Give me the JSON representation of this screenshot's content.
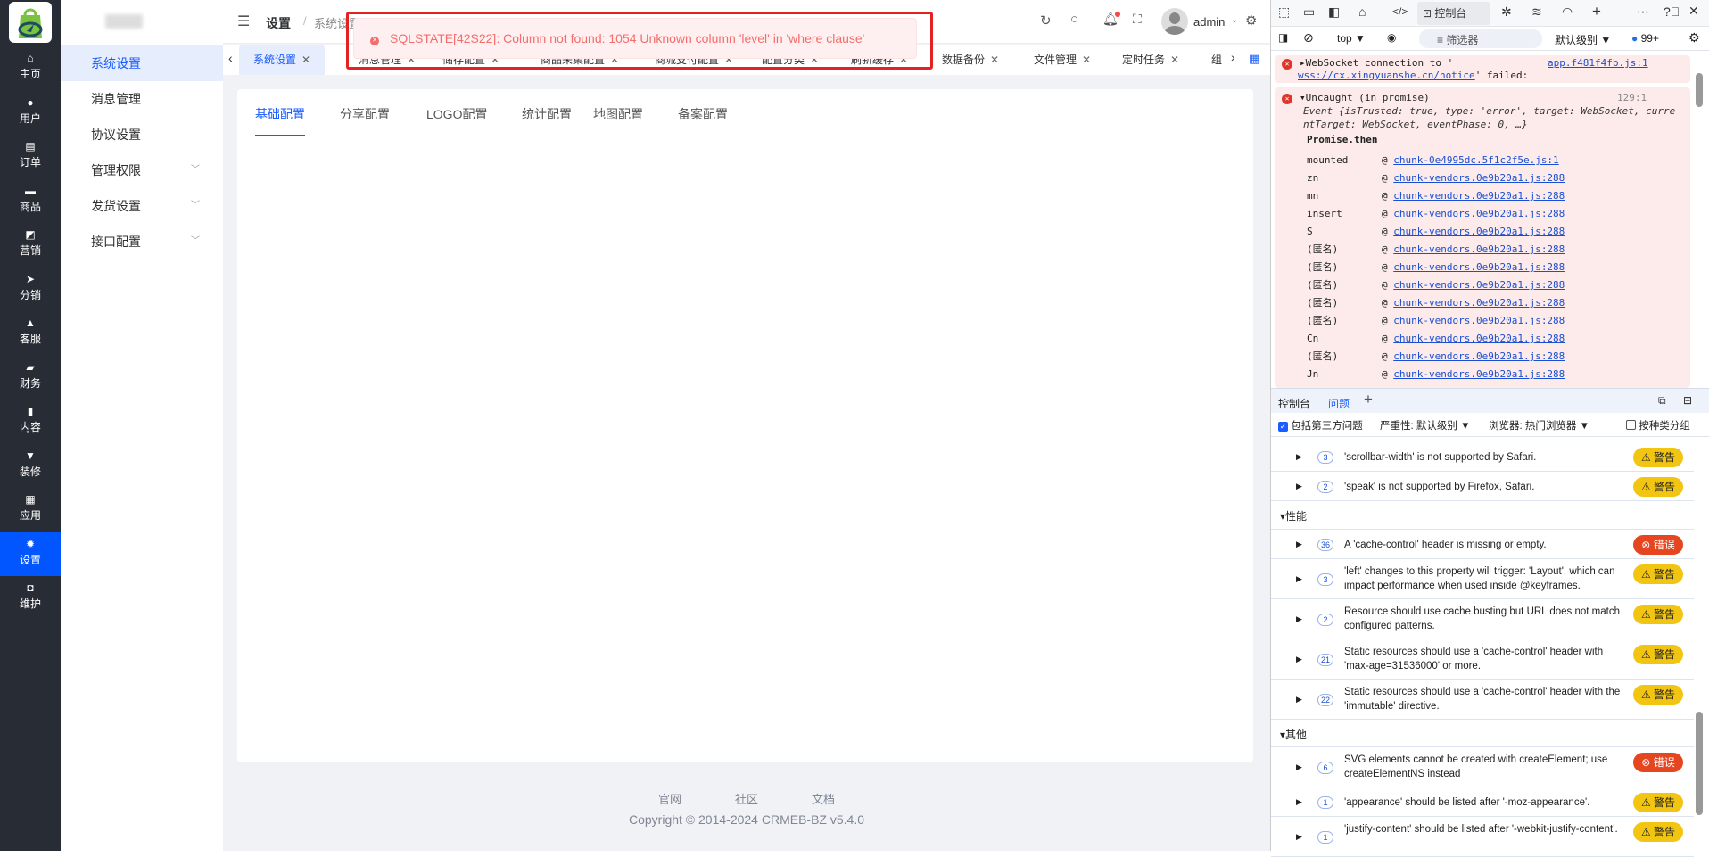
{
  "nav": {
    "items": [
      {
        "icon": "home-icon",
        "label": "主页"
      },
      {
        "icon": "user-icon",
        "label": "用户"
      },
      {
        "icon": "order-icon",
        "label": "订单"
      },
      {
        "icon": "product-icon",
        "label": "商品"
      },
      {
        "icon": "marketing-icon",
        "label": "营销"
      },
      {
        "icon": "send-icon",
        "label": "分销"
      },
      {
        "icon": "bell-icon",
        "label": "客服"
      },
      {
        "icon": "wallet-icon",
        "label": "财务"
      },
      {
        "icon": "content-icon",
        "label": "内容"
      },
      {
        "icon": "decor-icon",
        "label": "装修"
      },
      {
        "icon": "apps-icon",
        "label": "应用"
      },
      {
        "icon": "gear-icon",
        "label": "设置",
        "active": true
      },
      {
        "icon": "chip-icon",
        "label": "维护"
      }
    ]
  },
  "submenu": {
    "items": [
      {
        "label": "系统设置",
        "active": true
      },
      {
        "label": "消息管理"
      },
      {
        "label": "协议设置"
      },
      {
        "label": "管理权限",
        "expandable": true
      },
      {
        "label": "发货设置",
        "expandable": true
      },
      {
        "label": "接口配置",
        "expandable": true
      }
    ]
  },
  "header": {
    "breadcrumb": [
      "设置",
      "系统设置"
    ],
    "user": "admin"
  },
  "tabs": [
    {
      "label": "系统设置",
      "active": true
    },
    {
      "label": "消息管理"
    },
    {
      "label": "储存配置"
    },
    {
      "label": "商品采集配置"
    },
    {
      "label": "商城支付配置"
    },
    {
      "label": "配置分类"
    },
    {
      "label": "刷新缓存"
    },
    {
      "label": "数据备份"
    },
    {
      "label": "文件管理"
    },
    {
      "label": "定时任务"
    },
    {
      "label": "组"
    }
  ],
  "content": {
    "tabs": [
      {
        "label": "基础配置",
        "active": true
      },
      {
        "label": "分享配置"
      },
      {
        "label": "LOGO配置"
      },
      {
        "label": "统计配置"
      },
      {
        "label": "地图配置"
      },
      {
        "label": "备案配置"
      }
    ]
  },
  "toast": {
    "message": "SQLSTATE[42S22]: Column not found: 1054 Unknown column 'level' in 'where clause'"
  },
  "footer": {
    "links": [
      "官网",
      "社区",
      "文档"
    ],
    "copyright": "Copyright © 2014-2024 CRMEB-BZ v5.4.0"
  },
  "devtools": {
    "active_tab": "控制台",
    "context": "top",
    "filter_placeholder": "筛选器",
    "level": "默认级别",
    "badge": "99+",
    "console": {
      "ws_msg": "WebSocket connection to '",
      "ws_url": "wss://cx.xingyuanshe.cn/notice",
      "ws_tail": "' failed:",
      "ws_src": "app.f481f4fb.js:1",
      "uncaught": "Uncaught (in promise)",
      "uncaught_src": "129:1",
      "event": "Event {isTrusted: true, type: 'error', target: WebSocket, currentTarget: WebSocket, eventPhase: 0, …}",
      "promise_then": "Promise.then",
      "stack": [
        {
          "fn": "mounted",
          "src": "chunk-0e4995dc.5f1c2f5e.js:1"
        },
        {
          "fn": "zn",
          "src": "chunk-vendors.0e9b20a1.js:288"
        },
        {
          "fn": "mn",
          "src": "chunk-vendors.0e9b20a1.js:288"
        },
        {
          "fn": "insert",
          "src": "chunk-vendors.0e9b20a1.js:288"
        },
        {
          "fn": "S",
          "src": "chunk-vendors.0e9b20a1.js:288"
        },
        {
          "fn": "(匿名)",
          "src": "chunk-vendors.0e9b20a1.js:288"
        },
        {
          "fn": "(匿名)",
          "src": "chunk-vendors.0e9b20a1.js:288"
        },
        {
          "fn": "(匿名)",
          "src": "chunk-vendors.0e9b20a1.js:288"
        },
        {
          "fn": "(匿名)",
          "src": "chunk-vendors.0e9b20a1.js:288"
        },
        {
          "fn": "(匿名)",
          "src": "chunk-vendors.0e9b20a1.js:288"
        },
        {
          "fn": "Cn",
          "src": "chunk-vendors.0e9b20a1.js:288"
        },
        {
          "fn": "(匿名)",
          "src": "chunk-vendors.0e9b20a1.js:288"
        },
        {
          "fn": "Jn",
          "src": "chunk-vendors.0e9b20a1.js:288"
        }
      ]
    },
    "drawer": {
      "tabs": [
        "控制台",
        "问题"
      ],
      "active": "问题",
      "third_party": "包括第三方问题",
      "severity": "严重性: 默认级别",
      "browser": "浏览器:  热门浏览器",
      "group": "按种类分组"
    },
    "issues": [
      {
        "count": "3",
        "msg": "'scrollbar-width' is not supported by Safari.",
        "level": "警告"
      },
      {
        "count": "2",
        "msg": "'speak' is not supported by Firefox, Safari.",
        "level": "警告"
      },
      {
        "group": "性能"
      },
      {
        "count": "36",
        "msg": "A 'cache-control' header is missing or empty.",
        "level": "错误"
      },
      {
        "count": "3",
        "msg": "'left' changes to this property will trigger: 'Layout', which can impact performance when used inside @keyframes.",
        "level": "警告"
      },
      {
        "count": "2",
        "msg": "Resource should use cache busting but URL does not match configured patterns.",
        "level": "警告"
      },
      {
        "count": "21",
        "msg": "Static resources should use a 'cache-control' header with 'max-age=31536000' or more.",
        "level": "警告"
      },
      {
        "count": "22",
        "msg": "Static resources should use a 'cache-control' header with the 'immutable' directive.",
        "level": "警告"
      },
      {
        "group": "其他"
      },
      {
        "count": "6",
        "msg": "SVG elements cannot be created with createElement; use createElementNS instead",
        "level": "错误"
      },
      {
        "count": "1",
        "msg": "'appearance' should be listed after '-moz-appearance'.",
        "level": "警告"
      },
      {
        "count": "1",
        "msg": "'justify-content' should be listed after '-webkit-justify-content'.",
        "level": "警告"
      }
    ],
    "colors": {
      "warning": "#f2c512",
      "error": "#e5461f",
      "accent": "#0256ff"
    }
  }
}
